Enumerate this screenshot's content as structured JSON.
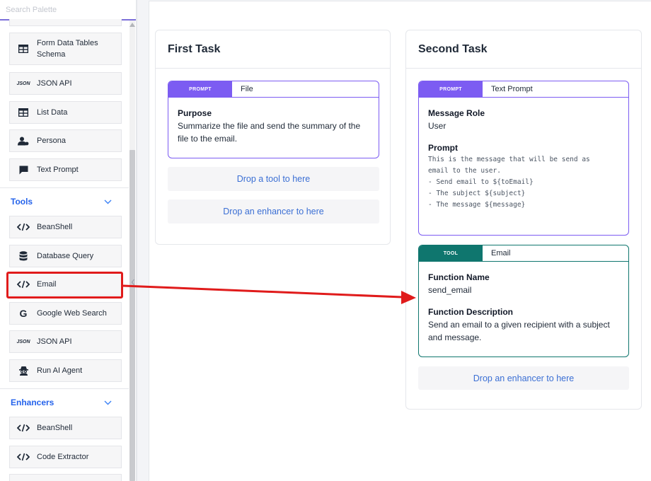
{
  "palette": {
    "search_placeholder": "Search Palette",
    "items": [
      {
        "label": "Form Data Tables Schema",
        "icon": "table-icon"
      },
      {
        "label": "JSON API",
        "icon": "json-icon",
        "icon_text": "JSON"
      },
      {
        "label": "List Data",
        "icon": "table-icon"
      },
      {
        "label": "Persona",
        "icon": "persona-icon"
      },
      {
        "label": "Text Prompt",
        "icon": "chat-icon"
      }
    ],
    "tools": {
      "title": "Tools",
      "items": [
        {
          "label": "BeanShell",
          "icon": "code-icon"
        },
        {
          "label": "Database Query",
          "icon": "database-icon"
        },
        {
          "label": "Email",
          "icon": "code-icon"
        },
        {
          "label": "Google Web Search",
          "icon": "google-icon",
          "icon_text": "G"
        },
        {
          "label": "JSON API",
          "icon": "json-icon",
          "icon_text": "JSON"
        },
        {
          "label": "Run AI Agent",
          "icon": "agent-icon"
        }
      ]
    },
    "enhancers": {
      "title": "Enhancers",
      "items": [
        {
          "label": "BeanShell",
          "icon": "code-icon"
        },
        {
          "label": "Code Extractor",
          "icon": "code-icon"
        }
      ]
    }
  },
  "tasks": [
    {
      "title": "First Task",
      "card": {
        "tag": "PROMPT",
        "name": "File",
        "fields": [
          {
            "label": "Purpose",
            "value": "Summarize the file and send the summary of the file to the email."
          }
        ]
      },
      "drop_tool": "Drop a tool to here",
      "drop_enhancer": "Drop an enhancer to here"
    },
    {
      "title": "Second Task",
      "card": {
        "tag": "PROMPT",
        "name": "Text Prompt",
        "fields": [
          {
            "label": "Message Role",
            "value": "User"
          },
          {
            "label": "Prompt",
            "value": "This is the message that will be send as\nemail to the user.\n- Send email to ${toEmail}\n- The subject ${subject}\n- The message ${message}"
          }
        ]
      },
      "tool_card": {
        "tag": "TOOL",
        "name": "Email",
        "fields": [
          {
            "label": "Function Name",
            "value": "send_email"
          },
          {
            "label": "Function Description",
            "value": "Send an email to a given recipient with a subject and message."
          }
        ]
      },
      "drop_enhancer": "Drop an enhancer to here"
    }
  ],
  "colors": {
    "prompt_accent": "#7c5cf2",
    "tool_accent": "#0f766e",
    "link_blue": "#2563eb",
    "annotation_red": "#e01b1b"
  }
}
